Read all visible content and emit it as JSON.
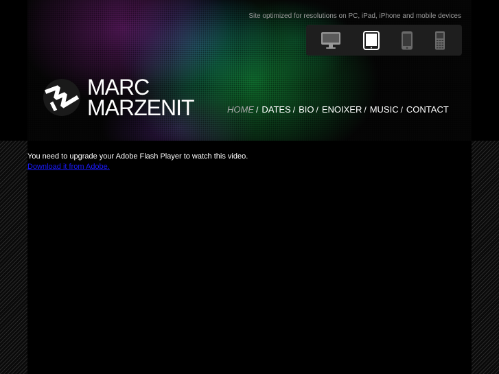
{
  "header": {
    "optimized_text": "Site optimized for resolutions on PC, iPad, iPhone and mobile devices",
    "devices": [
      {
        "name": "desktop",
        "icon": "monitor-icon",
        "active": false
      },
      {
        "name": "ipad",
        "icon": "tablet-icon",
        "active": true
      },
      {
        "name": "iphone",
        "icon": "smartphone-icon",
        "active": false
      },
      {
        "name": "mobile",
        "icon": "mobile-phone-icon",
        "active": false
      }
    ]
  },
  "logo": {
    "line1": "MARC",
    "line2": "MARZENIT"
  },
  "nav": {
    "items": [
      {
        "label": "HOME",
        "active": true
      },
      {
        "label": "DATES",
        "active": false
      },
      {
        "label": "BIO",
        "active": false
      },
      {
        "label": "ENOIXER",
        "active": false
      },
      {
        "label": "MUSIC",
        "active": false
      },
      {
        "label": "CONTACT",
        "active": false
      }
    ],
    "separator": "/"
  },
  "content": {
    "flash_message": "You need to upgrade your Adobe Flash Player to watch this video.",
    "download_link": "Download it from Adobe."
  },
  "colors": {
    "background": "#000000",
    "nav_active": "#a8a8a8",
    "link": "#1a1aff",
    "device_bar": "#1e1e1e"
  }
}
